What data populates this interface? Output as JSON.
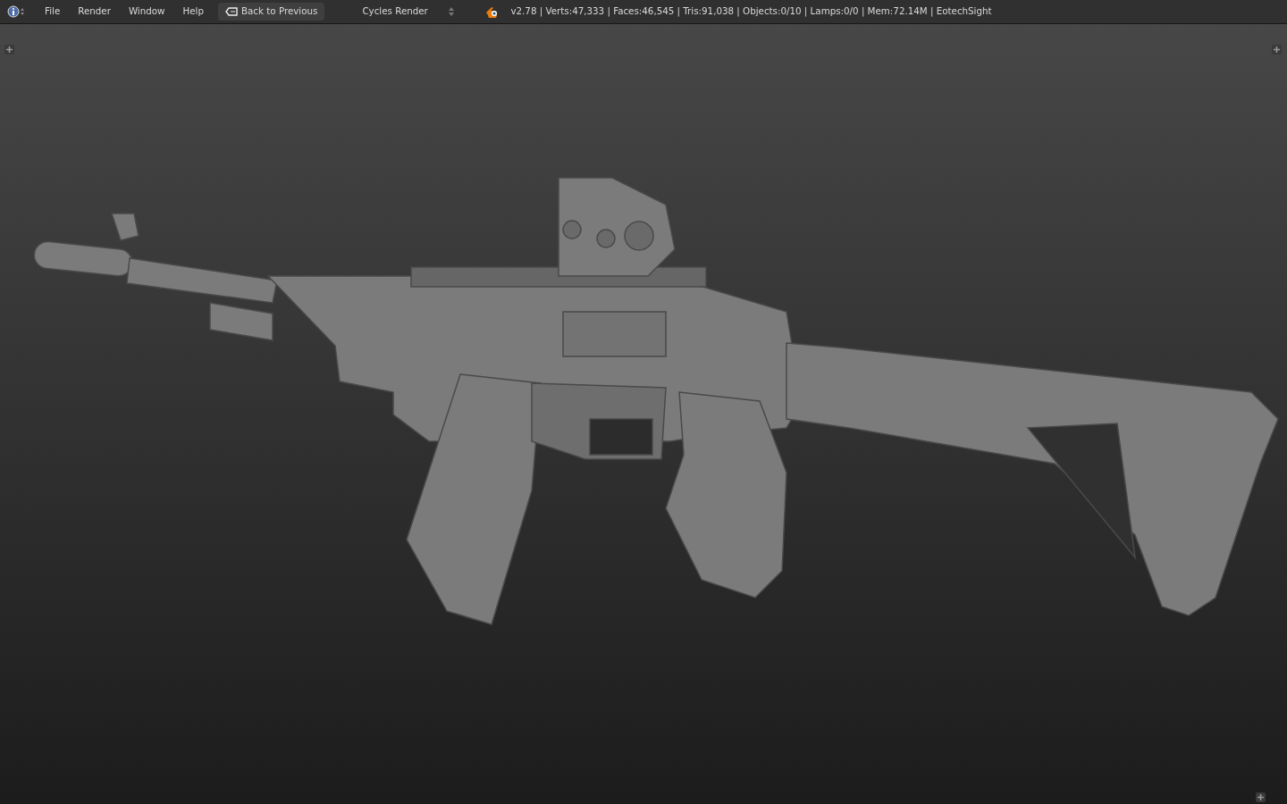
{
  "header": {
    "menus": [
      "File",
      "Render",
      "Window",
      "Help"
    ],
    "back_button": "Back to Previous",
    "render_engine": "Cycles Render",
    "stats": "v2.78 | Verts:47,333 | Faces:46,545 | Tris:91,038 | Objects:0/10 | Lamps:0/0 | Mem:72.14M | EotechSight"
  }
}
